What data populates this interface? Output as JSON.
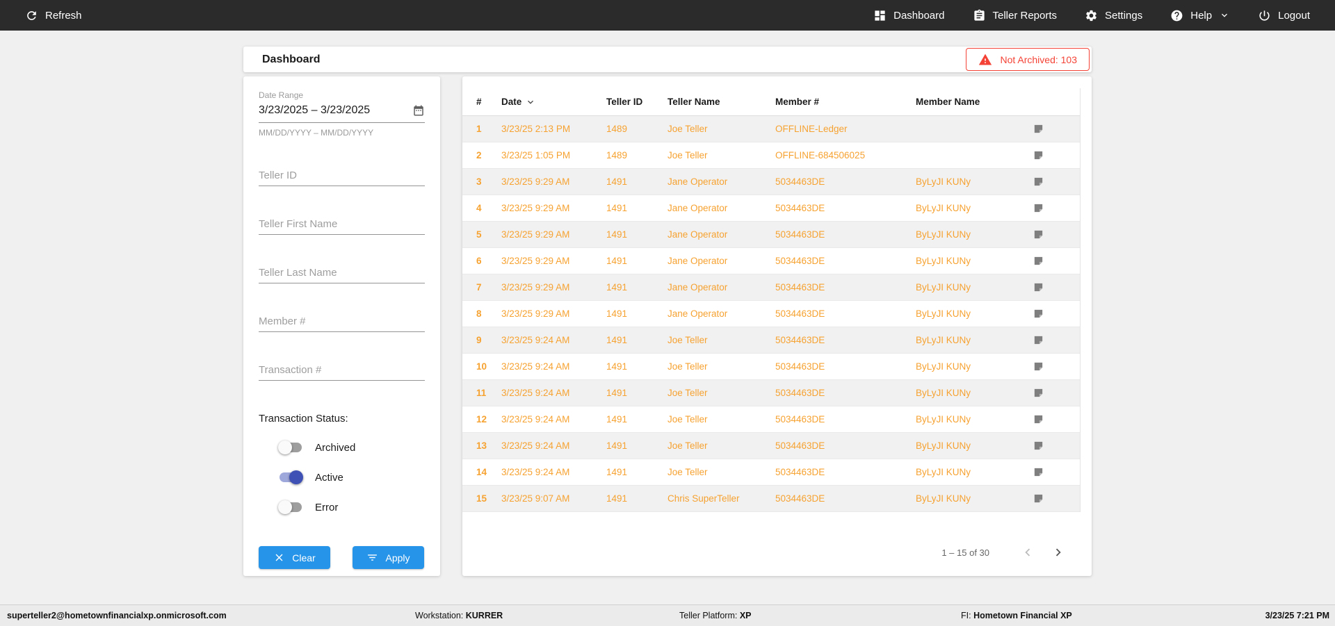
{
  "topnav": {
    "refresh": {
      "label": "Refresh",
      "icon": "refresh-icon"
    },
    "items": [
      {
        "label": "Dashboard",
        "icon": "dashboard-icon"
      },
      {
        "label": "Teller Reports",
        "icon": "clipboard-icon"
      },
      {
        "label": "Settings",
        "icon": "gear-icon"
      },
      {
        "label": "Help",
        "icon": "help-icon",
        "has_dropdown": true
      },
      {
        "label": "Logout",
        "icon": "power-icon"
      }
    ]
  },
  "header": {
    "title": "Dashboard",
    "alert": {
      "label": "Not Archived: 103",
      "icon": "warning-icon",
      "color": "#f44336"
    }
  },
  "filters": {
    "date_range": {
      "label": "Date Range",
      "value": "3/23/2025 – 3/23/2025",
      "hint": "MM/DD/YYYY – MM/DD/YYYY",
      "icon": "calendar-icon"
    },
    "inputs": [
      {
        "placeholder": "Teller ID"
      },
      {
        "placeholder": "Teller First Name"
      },
      {
        "placeholder": "Teller Last Name"
      },
      {
        "placeholder": "Member #"
      },
      {
        "placeholder": "Transaction #"
      }
    ],
    "status": {
      "label": "Transaction Status:",
      "toggles": [
        {
          "label": "Archived",
          "on": false
        },
        {
          "label": "Active",
          "on": true
        },
        {
          "label": "Error",
          "on": false
        }
      ]
    },
    "clear_label": "Clear",
    "apply_label": "Apply",
    "clear_icon": "close-icon",
    "apply_icon": "filter-icon"
  },
  "table": {
    "columns": [
      "#",
      "Date",
      "Teller ID",
      "Teller Name",
      "Member #",
      "Member Name"
    ],
    "sorted_column": "Date",
    "sort_direction": "desc",
    "row_icon": "note-icon",
    "rows": [
      {
        "num": "1",
        "date": "3/23/25 2:13 PM",
        "teller_id": "1489",
        "teller_name": "Joe Teller",
        "member_num": "OFFLINE-Ledger",
        "member_name": ""
      },
      {
        "num": "2",
        "date": "3/23/25 1:05 PM",
        "teller_id": "1489",
        "teller_name": "Joe Teller",
        "member_num": "OFFLINE-684506025",
        "member_name": ""
      },
      {
        "num": "3",
        "date": "3/23/25 9:29 AM",
        "teller_id": "1491",
        "teller_name": "Jane Operator",
        "member_num": "5034463DE",
        "member_name": "ByLyJI KUNy"
      },
      {
        "num": "4",
        "date": "3/23/25 9:29 AM",
        "teller_id": "1491",
        "teller_name": "Jane Operator",
        "member_num": "5034463DE",
        "member_name": "ByLyJI KUNy"
      },
      {
        "num": "5",
        "date": "3/23/25 9:29 AM",
        "teller_id": "1491",
        "teller_name": "Jane Operator",
        "member_num": "5034463DE",
        "member_name": "ByLyJI KUNy"
      },
      {
        "num": "6",
        "date": "3/23/25 9:29 AM",
        "teller_id": "1491",
        "teller_name": "Jane Operator",
        "member_num": "5034463DE",
        "member_name": "ByLyJI KUNy"
      },
      {
        "num": "7",
        "date": "3/23/25 9:29 AM",
        "teller_id": "1491",
        "teller_name": "Jane Operator",
        "member_num": "5034463DE",
        "member_name": "ByLyJI KUNy"
      },
      {
        "num": "8",
        "date": "3/23/25 9:29 AM",
        "teller_id": "1491",
        "teller_name": "Jane Operator",
        "member_num": "5034463DE",
        "member_name": "ByLyJI KUNy"
      },
      {
        "num": "9",
        "date": "3/23/25 9:24 AM",
        "teller_id": "1491",
        "teller_name": "Joe Teller",
        "member_num": "5034463DE",
        "member_name": "ByLyJI KUNy"
      },
      {
        "num": "10",
        "date": "3/23/25 9:24 AM",
        "teller_id": "1491",
        "teller_name": "Joe Teller",
        "member_num": "5034463DE",
        "member_name": "ByLyJI KUNy"
      },
      {
        "num": "11",
        "date": "3/23/25 9:24 AM",
        "teller_id": "1491",
        "teller_name": "Joe Teller",
        "member_num": "5034463DE",
        "member_name": "ByLyJI KUNy"
      },
      {
        "num": "12",
        "date": "3/23/25 9:24 AM",
        "teller_id": "1491",
        "teller_name": "Joe Teller",
        "member_num": "5034463DE",
        "member_name": "ByLyJI KUNy"
      },
      {
        "num": "13",
        "date": "3/23/25 9:24 AM",
        "teller_id": "1491",
        "teller_name": "Joe Teller",
        "member_num": "5034463DE",
        "member_name": "ByLyJI KUNy"
      },
      {
        "num": "14",
        "date": "3/23/25 9:24 AM",
        "teller_id": "1491",
        "teller_name": "Joe Teller",
        "member_num": "5034463DE",
        "member_name": "ByLyJI KUNy"
      },
      {
        "num": "15",
        "date": "3/23/25 9:07 AM",
        "teller_id": "1491",
        "teller_name": "Chris SuperTeller",
        "member_num": "5034463DE",
        "member_name": "ByLyJI KUNy"
      }
    ],
    "pagination": {
      "label": "1 – 15 of 30",
      "prev_enabled": false,
      "next_enabled": true
    }
  },
  "footer": {
    "user": "superteller2@hometownfinancialxp.onmicrosoft.com",
    "workstation_label": "Workstation:",
    "workstation_value": "KURRER",
    "platform_label": "Teller Platform:",
    "platform_value": "XP",
    "fi_label": "FI:",
    "fi_value": "Hometown Financial XP",
    "timestamp": "3/23/25 7:21 PM"
  },
  "colors": {
    "topbar": "#2b2b2b",
    "accent_orange": "#f6a231",
    "accent_blue": "#2694e8",
    "alert_red": "#f44336",
    "toggle_on": "#3f51b5"
  }
}
